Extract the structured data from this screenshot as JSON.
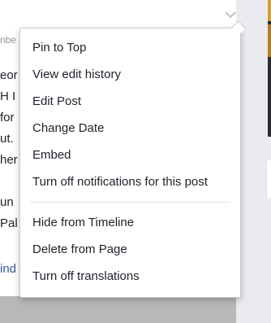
{
  "post": {
    "meta_fragment": "nbe",
    "text_lines": [
      "eor",
      "H I",
      "for",
      "ut.",
      "her",
      "",
      "un",
      "Pal"
    ],
    "link_fragment": "ind"
  },
  "menu": {
    "group1": [
      "Pin to Top",
      "View edit history",
      "Edit Post",
      "Change Date",
      "Embed",
      "Turn off notifications for this post"
    ],
    "group2": [
      "Hide from Timeline",
      "Delete from Page",
      "Turn off translations"
    ]
  },
  "icons": {
    "chevron": "chevron-down-icon"
  }
}
